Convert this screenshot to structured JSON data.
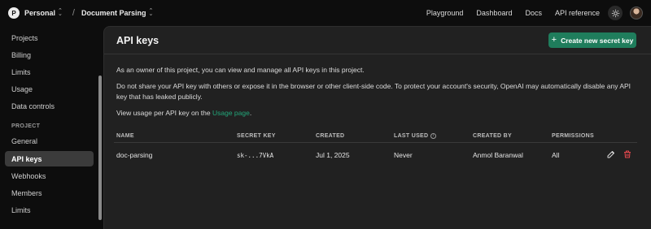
{
  "topbar": {
    "org_initial": "P",
    "org_name": "Personal",
    "separator": "/",
    "project_name": "Document Parsing",
    "links": [
      "Playground",
      "Dashboard",
      "Docs",
      "API reference"
    ]
  },
  "sidebar": {
    "top_items": [
      "Projects",
      "Billing",
      "Limits",
      "Usage",
      "Data controls"
    ],
    "section_label": "PROJECT",
    "project_items": [
      "General",
      "API keys",
      "Webhooks",
      "Members",
      "Limits"
    ],
    "active_item": "API keys"
  },
  "main": {
    "title": "API keys",
    "create_button": "Create new secret key",
    "para1": "As an owner of this project, you can view and manage all API keys in this project.",
    "para2": "Do not share your API key with others or expose it in the browser or other client-side code. To protect your account's security, OpenAI may automatically disable any API key that has leaked publicly.",
    "para3_prefix": "View usage per API key on the ",
    "para3_link": "Usage page",
    "para3_suffix": "."
  },
  "table": {
    "headers": [
      "NAME",
      "SECRET KEY",
      "CREATED",
      "LAST USED",
      "CREATED BY",
      "PERMISSIONS"
    ],
    "rows": [
      {
        "name": "doc-parsing",
        "secret_key": "sk-...7VkA",
        "created": "Jul 1, 2025",
        "last_used": "Never",
        "created_by": "Anmol Baranwal",
        "permissions": "All"
      }
    ]
  },
  "icons": {
    "gear": "gear-icon",
    "edit": "pencil-icon",
    "delete": "trash-icon",
    "info": "info-icon"
  },
  "colors": {
    "accent": "#1f7d5c",
    "link": "#22a77a",
    "delete": "#e5484d"
  }
}
